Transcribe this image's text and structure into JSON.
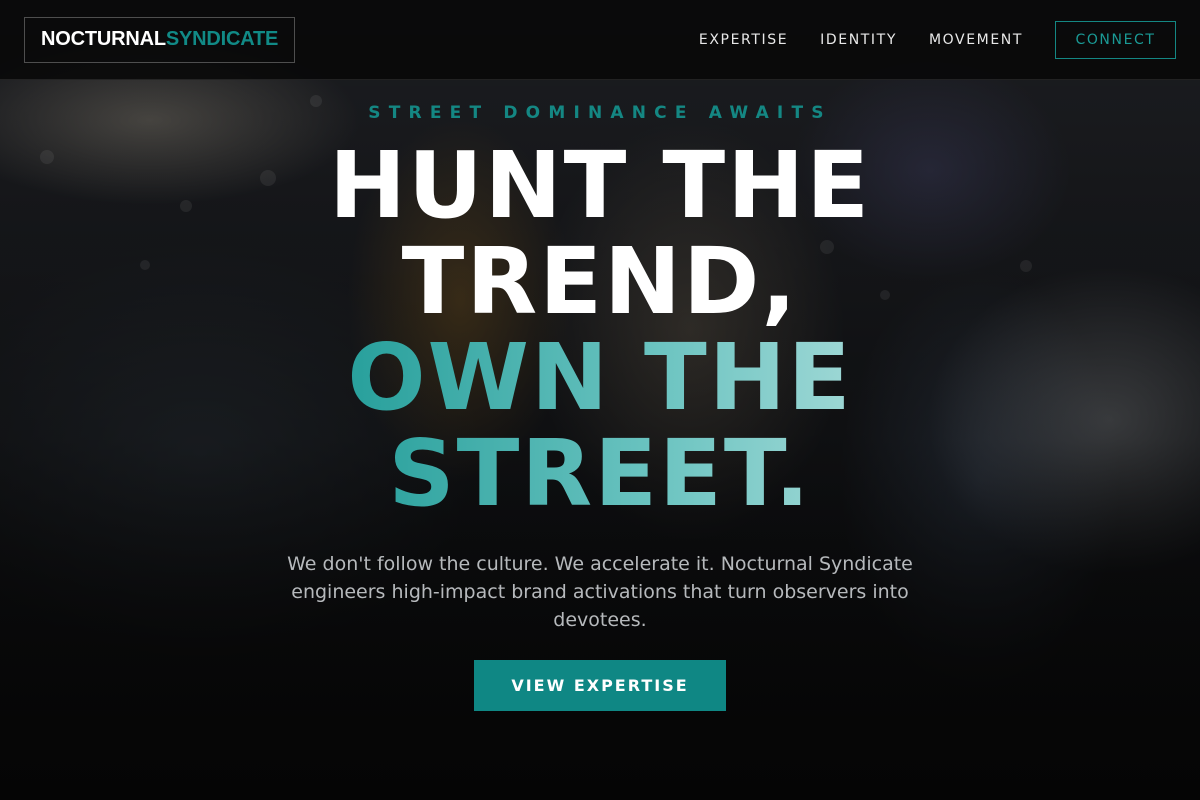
{
  "header": {
    "logo": {
      "part_a": "NOCTURNAL",
      "part_b": "SYNDICATE"
    },
    "nav": [
      {
        "label": "EXPERTISE"
      },
      {
        "label": "IDENTITY"
      },
      {
        "label": "MOVEMENT"
      }
    ],
    "connect_label": "CONNECT"
  },
  "hero": {
    "eyebrow": "STREET DOMINANCE AWAITS",
    "headline": {
      "line1": "HUNT THE",
      "line2": "TREND,",
      "line3": "OWN THE",
      "line4": "STREET."
    },
    "subtext": "We don't follow the culture. We accelerate it. Nocturnal Syndicate engineers high-impact brand activations that turn observers into devotees.",
    "cta_label": "VIEW EXPERTISE"
  },
  "colors": {
    "accent": "#0f8784",
    "background": "#0b0b0b",
    "text": "#ffffff",
    "muted_text": "#b6b9bc"
  }
}
